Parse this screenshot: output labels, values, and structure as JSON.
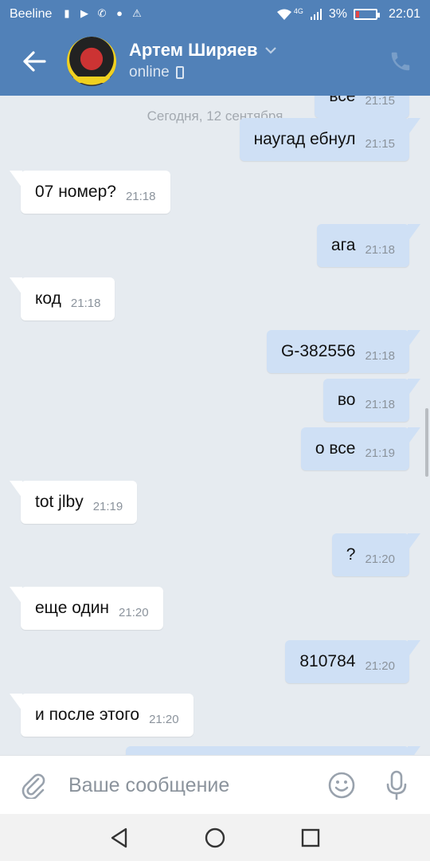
{
  "statusbar": {
    "carrier": "Beeline",
    "network": "4G",
    "battery": "3%",
    "time": "22:01",
    "icons": [
      "sim-icon",
      "youtube-icon",
      "viber-icon",
      "message-icon",
      "warning-icon",
      "wifi-icon",
      "signal-icon",
      "battery-icon"
    ]
  },
  "header": {
    "name": "Артем Ширяев",
    "status": "online",
    "back_icon": "arrow-left-icon",
    "call_icon": "phone-icon"
  },
  "chat": {
    "date_label": "Сегодня, 12 сентября",
    "messages": [
      {
        "dir": "out",
        "text": "все",
        "time": "21:15"
      },
      {
        "dir": "out",
        "text": "наугад ебнул",
        "time": "21:15"
      },
      {
        "dir": "in",
        "text": "07 номер?",
        "time": "21:18"
      },
      {
        "dir": "out",
        "text": "ага",
        "time": "21:18"
      },
      {
        "dir": "in",
        "text": "код",
        "time": "21:18"
      },
      {
        "dir": "out",
        "text": "G-382556",
        "time": "21:18"
      },
      {
        "dir": "out",
        "text": "во",
        "time": "21:18"
      },
      {
        "dir": "out",
        "text": "о все",
        "time": "21:19"
      },
      {
        "dir": "in",
        "text": "tot jlby",
        "time": "21:19"
      },
      {
        "dir": "out",
        "text": "?",
        "time": "21:20"
      },
      {
        "dir": "in",
        "text": "еще один",
        "time": "21:20"
      },
      {
        "dir": "out",
        "text": "810784",
        "time": "21:20"
      },
      {
        "dir": "in",
        "text": "и после этого",
        "time": "21:20"
      }
    ]
  },
  "composer": {
    "placeholder": "Ваше сообщение",
    "attach_icon": "paperclip-icon",
    "emoji_icon": "smiley-icon",
    "mic_icon": "microphone-icon"
  },
  "colors": {
    "header": "#5181b8",
    "background": "#e6ebf0",
    "outgoing_bubble": "#cfe0f5",
    "incoming_bubble": "#ffffff"
  }
}
